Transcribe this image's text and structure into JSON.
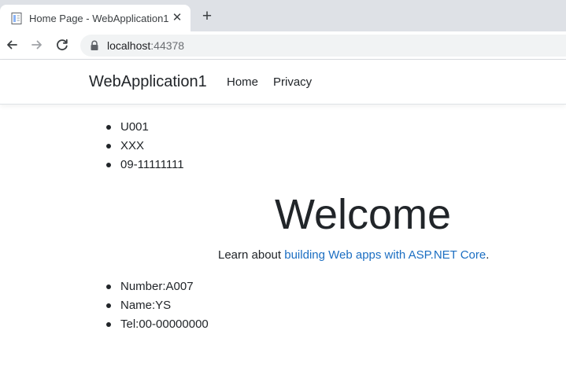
{
  "browser": {
    "tab_title": "Home Page - WebApplication1",
    "url_host": "localhost",
    "url_port": ":44378"
  },
  "navbar": {
    "brand": "WebApplication1",
    "links": [
      "Home",
      "Privacy"
    ]
  },
  "list_top": [
    "U001",
    "XXX",
    "09-11111111"
  ],
  "welcome": {
    "heading": "Welcome",
    "learn_prefix": "Learn about ",
    "learn_link": "building Web apps with ASP.NET Core",
    "learn_suffix": "."
  },
  "list_bottom": [
    "Number:A007",
    "Name:YS",
    "Tel:00-00000000"
  ],
  "colors": {
    "link": "#1b6ec2",
    "text": "#212529",
    "tabstrip": "#dee1e6"
  }
}
